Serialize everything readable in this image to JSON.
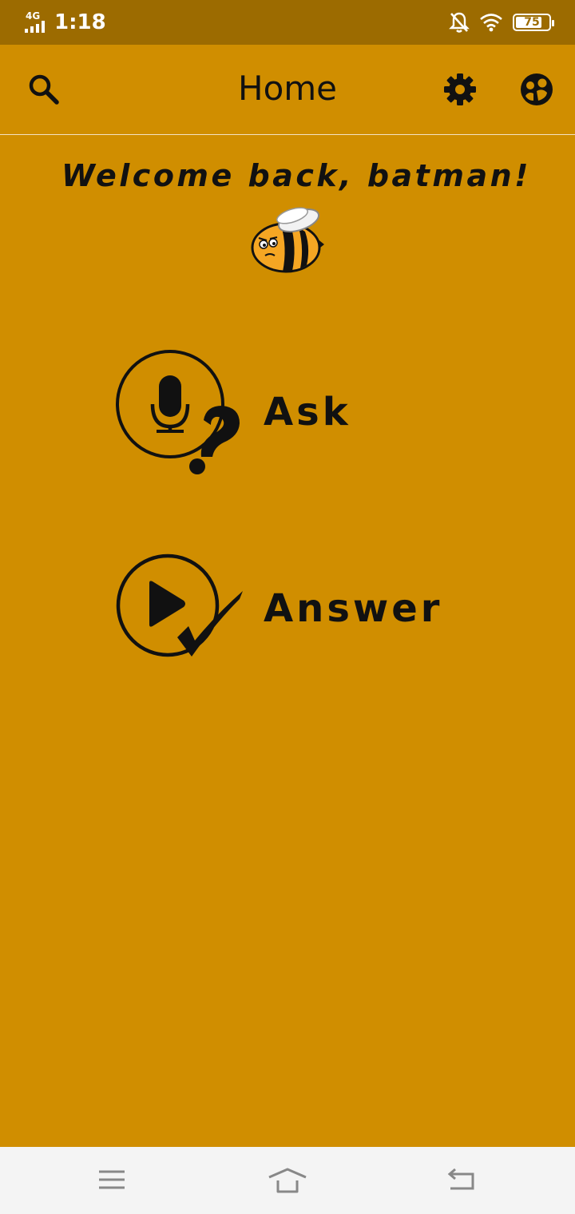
{
  "status_bar": {
    "network": "4G",
    "time": "1:18",
    "battery": "75",
    "icons": [
      "signal-icon",
      "notifications-off-icon",
      "wifi-icon",
      "battery-icon"
    ]
  },
  "app_bar": {
    "title": "Home",
    "icons": [
      "search-icon",
      "gear-icon",
      "profile-icon"
    ]
  },
  "welcome": {
    "text": "Welcome back, batman!",
    "mascot": "bee-icon"
  },
  "actions": [
    {
      "label": "Ask",
      "icon": "microphone-question-icon"
    },
    {
      "label": "Answer",
      "icon": "play-check-icon"
    }
  ],
  "nav_bar": {
    "icons": [
      "menu-icon",
      "home-icon",
      "back-icon"
    ]
  },
  "colors": {
    "background": "#D08E00",
    "status_bar": "#9C6B00",
    "nav_bar": "#F4F4F4",
    "text": "#111111"
  }
}
